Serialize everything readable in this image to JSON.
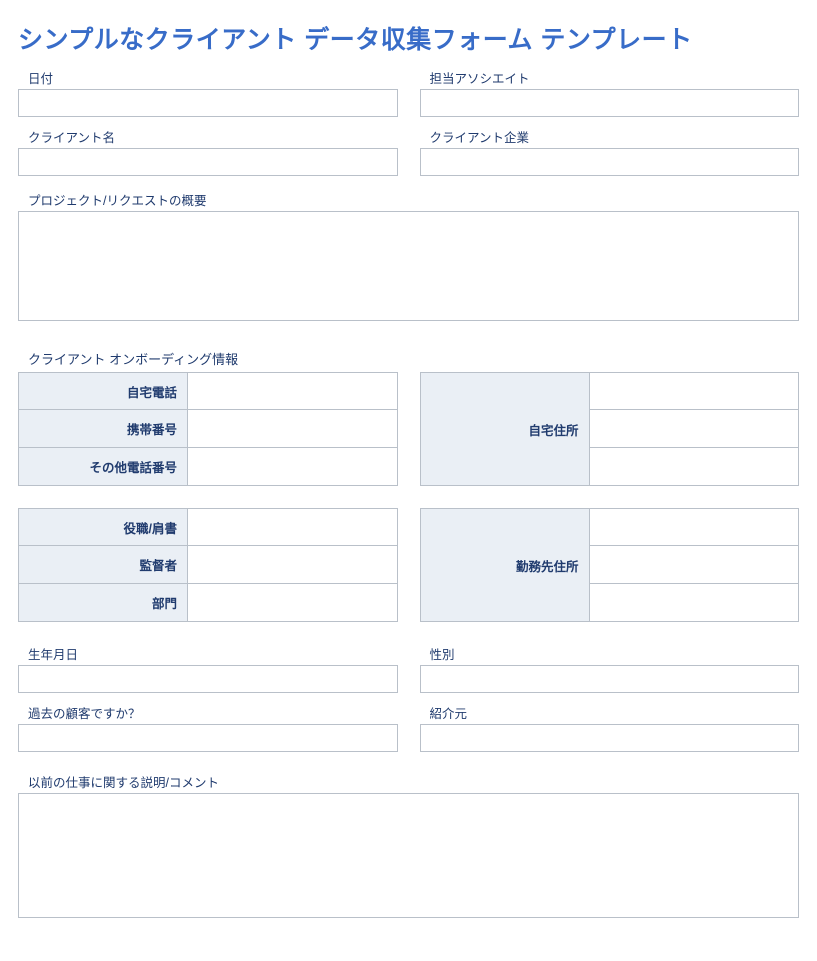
{
  "title": "シンプルなクライアント データ収集フォーム テンプレート",
  "fields": {
    "date_label": "日付",
    "associate_label": "担当アソシエイト",
    "client_name_label": "クライアント名",
    "client_company_label": "クライアント企業",
    "project_overview_label": "プロジェクト/リクエストの概要",
    "onboarding_section_label": "クライアント オンボーディング情報",
    "home_phone_label": "自宅電話",
    "mobile_label": "携帯番号",
    "other_phone_label": "その他電話番号",
    "home_address_label": "自宅住所",
    "title_position_label": "役職/肩書",
    "supervisor_label": "監督者",
    "department_label": "部門",
    "work_address_label": "勤務先住所",
    "dob_label": "生年月日",
    "gender_label": "性別",
    "past_client_label": "過去の顧客ですか？",
    "referral_label": "紹介元",
    "prev_work_label": "以前の仕事に関する説明/コメント"
  },
  "values": {
    "date": "",
    "associate": "",
    "client_name": "",
    "client_company": "",
    "project_overview": "",
    "home_phone": "",
    "mobile": "",
    "other_phone": "",
    "home_addr1": "",
    "home_addr2": "",
    "home_addr3": "",
    "title_position": "",
    "supervisor": "",
    "department": "",
    "work_addr1": "",
    "work_addr2": "",
    "work_addr3": "",
    "dob": "",
    "gender": "",
    "past_client": "",
    "referral": "",
    "prev_work": ""
  }
}
